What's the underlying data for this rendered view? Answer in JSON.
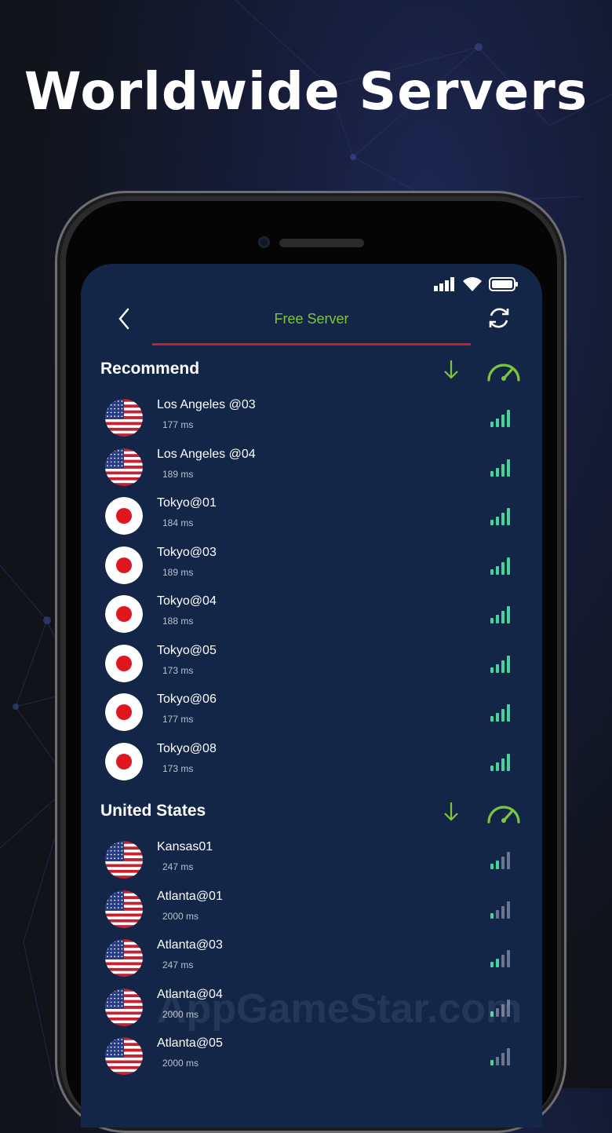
{
  "headline": "Worldwide Servers",
  "header": {
    "title": "Free Server",
    "back_icon": "chevron-left-icon",
    "refresh_icon": "refresh-icon"
  },
  "status_icons": [
    "cellular-signal-icon",
    "wifi-icon",
    "battery-icon"
  ],
  "colors": {
    "accent_green": "#7ec53f",
    "underline_red": "#c5202c",
    "screen_bg": "#132648",
    "signal_bar": "#49d39a"
  },
  "sections": [
    {
      "title": "Recommend",
      "servers": [
        {
          "name": "Los Angeles @03",
          "ping": "177 ms",
          "flag": "us-flag-icon",
          "signal": 4
        },
        {
          "name": "Los Angeles @04",
          "ping": "189 ms",
          "flag": "us-flag-icon",
          "signal": 4
        },
        {
          "name": "Tokyo@01",
          "ping": "184 ms",
          "flag": "japan-flag-icon",
          "signal": 4
        },
        {
          "name": "Tokyo@03",
          "ping": "189 ms",
          "flag": "japan-flag-icon",
          "signal": 4
        },
        {
          "name": "Tokyo@04",
          "ping": "188 ms",
          "flag": "japan-flag-icon",
          "signal": 4
        },
        {
          "name": "Tokyo@05",
          "ping": "173 ms",
          "flag": "japan-flag-icon",
          "signal": 4
        },
        {
          "name": "Tokyo@06",
          "ping": "177 ms",
          "flag": "japan-flag-icon",
          "signal": 4
        },
        {
          "name": "Tokyo@08",
          "ping": "173 ms",
          "flag": "japan-flag-icon",
          "signal": 4
        }
      ]
    },
    {
      "title": "United States",
      "servers": [
        {
          "name": "Kansas01",
          "ping": "247 ms",
          "flag": "us-flag-icon",
          "signal": 2
        },
        {
          "name": "Atlanta@01",
          "ping": "2000 ms",
          "flag": "us-flag-icon",
          "signal": 1
        },
        {
          "name": "Atlanta@03",
          "ping": "247 ms",
          "flag": "us-flag-icon",
          "signal": 2
        },
        {
          "name": "Atlanta@04",
          "ping": "2000 ms",
          "flag": "us-flag-icon",
          "signal": 1
        },
        {
          "name": "Atlanta@05",
          "ping": "2000 ms",
          "flag": "us-flag-icon",
          "signal": 1
        }
      ]
    }
  ],
  "watermark": "AppGameStar.com"
}
